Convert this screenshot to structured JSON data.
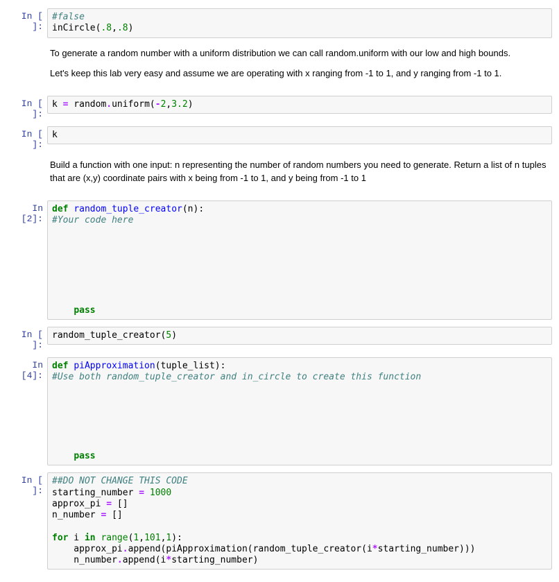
{
  "cells": [
    {
      "id": "c1",
      "prompt": "In [ ]:",
      "type": "code",
      "code": {
        "l1_comment": "#false",
        "l2_func": "inCircle(",
        "l2_a": ".8",
        "l2_c": ",",
        "l2_b": ".8",
        "l2_close": ")"
      }
    },
    {
      "id": "c2",
      "type": "md",
      "md": {
        "p1": "To generate a random number with a uniform distribution we can call random.uniform with our low and high bounds.",
        "p2": "Let's keep this lab very easy and assume we are operating with x ranging from -1 to 1, and y ranging from -1 to 1."
      }
    },
    {
      "id": "c3",
      "prompt": "In [ ]:",
      "type": "code",
      "code": {
        "t1": "k ",
        "op": "=",
        "t2": " random",
        "dot": ".",
        "fn": "uniform(",
        "a1": "-",
        "a1n": "2",
        "c": ",",
        "a2": "3.2",
        "close": ")"
      }
    },
    {
      "id": "c4",
      "prompt": "In [ ]:",
      "type": "code",
      "code": {
        "t": "k"
      }
    },
    {
      "id": "c5",
      "type": "md",
      "md": {
        "p1": "Build a function with one input: n representing the number of random numbers you need to generate. Return a list of n tuples that are (x,y) coordinate pairs with x being from -1 to 1, and y being from -1 to 1"
      }
    },
    {
      "id": "c6",
      "prompt": "In [2]:",
      "type": "code",
      "code": {
        "def": "def",
        "sp": " ",
        "name": "random_tuple_creator",
        "paren": "(n):",
        "comment": "#Your code here",
        "pass": "pass"
      }
    },
    {
      "id": "c7",
      "prompt": "In [ ]:",
      "type": "code",
      "code": {
        "fn": "random_tuple_creator(",
        "n": "5",
        "close": ")"
      }
    },
    {
      "id": "c8",
      "prompt": "In [4]:",
      "type": "code",
      "code": {
        "def": "def",
        "sp": " ",
        "name": "piApproximation",
        "paren": "(tuple_list):",
        "comment": "#Use both random_tuple_creator and in_circle to create this function",
        "pass": "pass"
      }
    },
    {
      "id": "c9",
      "prompt": "In [ ]:",
      "type": "code",
      "code": {
        "l1": "##DO NOT CHANGE THIS CODE",
        "l2a": "starting_number ",
        "l2op": "=",
        "l2sp": " ",
        "l2n": "1000",
        "l3a": "approx_pi ",
        "l3op": "=",
        "l3b": " []",
        "l4a": "n_number ",
        "l4op": "=",
        "l4b": " []",
        "l6for": "for",
        "l6sp1": " i ",
        "l6in": "in",
        "l6sp2": " ",
        "l6range": "range",
        "l6o": "(",
        "l6a": "1",
        "l6c1": ",",
        "l6b": "101",
        "l6c2": ",",
        "l6c": "1",
        "l6close": "):",
        "l7": "    approx_pi",
        "l7dot": ".",
        "l7app": "append(piApproximation(random_tuple_creator(i",
        "l7op": "*",
        "l7sn": "starting_number)))",
        "l8": "    n_number",
        "l8dot": ".",
        "l8app": "append(i",
        "l8op": "*",
        "l8sn": "starting_number)"
      }
    }
  ]
}
